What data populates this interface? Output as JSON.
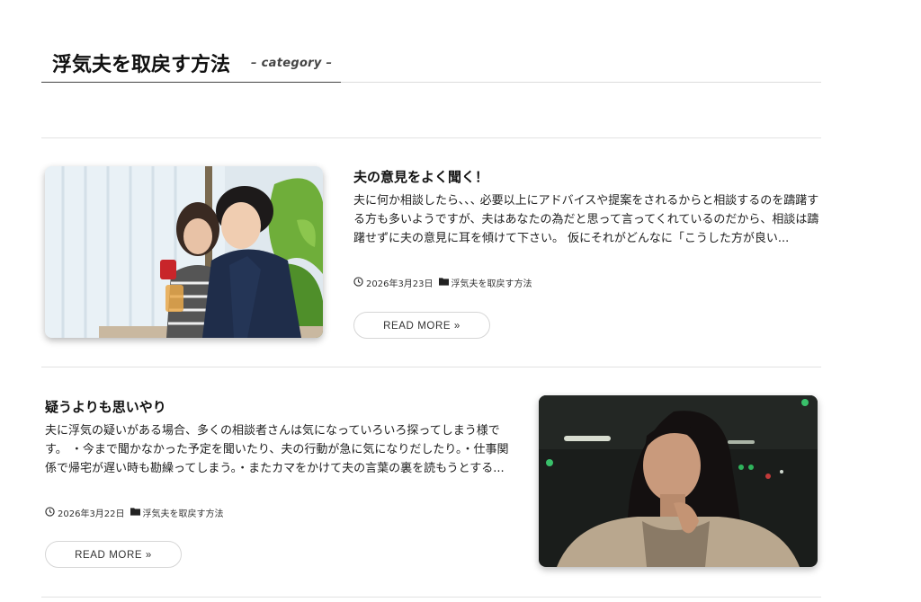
{
  "category_header": {
    "title": "浮気夫を取戻す方法",
    "subtitle": "– category –"
  },
  "posts": [
    {
      "title": "夫の意見をよく聞く！",
      "excerpt": "夫に何か相談したら､､､ 必要以上にアドバイスや提案をされるからと相談するのを躊躇する方も多いようですが、夫はあなたの為だと思って言ってくれているのだから、相談は躊躇せずに夫の意見に耳を傾けて下さい。 仮にそれがどんなに「こうした方が良い...",
      "date": "2026年3月23日",
      "category": "浮気夫を取戻す方法",
      "button": "READ MORE »",
      "image_icon": "couple-photo-icon"
    },
    {
      "title": "疑うよりも思いやり",
      "excerpt": "夫に浮気の疑いがある場合、多くの相談者さんは気になっていろいろ探ってしまう様です。 ・今まで聞かなかった予定を聞いたり、夫の行動が急に気になりだしたり。・仕事関係で帰宅が遅い時も勘繰ってしまう。・またカマをかけて夫の言葉の裏を読もうとする...",
      "date": "2026年3月22日",
      "category": "浮気夫を取戻す方法",
      "button": "READ MORE »",
      "image_icon": "woman-thinking-photo-icon"
    }
  ],
  "colors": {
    "text": "#222222",
    "divider": "#e2e2e2",
    "button_border": "#d6d6d6"
  }
}
